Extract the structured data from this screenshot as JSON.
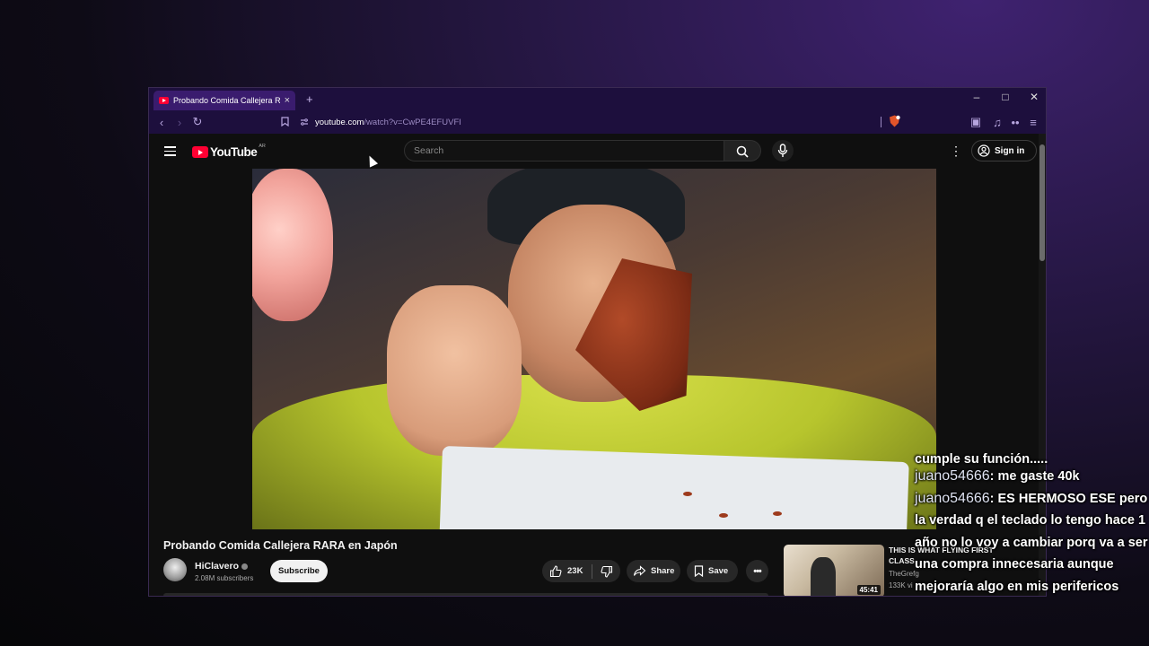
{
  "browser": {
    "tab_title": "Probando Comida Callejera RAR",
    "new_tab_label": "+",
    "close_label": "×",
    "url_host": "youtube.com",
    "url_path": "/watch?v=CwPE4EFUVFI",
    "window_controls": {
      "minimize": "–",
      "maximize": "□",
      "close": "✕"
    }
  },
  "youtube": {
    "logo_text": "YouTube",
    "country_code": "AR",
    "search_placeholder": "Search",
    "signin_label": "Sign in"
  },
  "video": {
    "title": "Probando Comida Callejera RARA en Japón",
    "channel": "HiClavero",
    "subscribers": "2.08M subscribers",
    "subscribe_label": "Subscribe",
    "likes": "23K",
    "share_label": "Share",
    "save_label": "Save"
  },
  "recommended": {
    "title_line1": "THIS IS WHAT FLYING FIRST",
    "title_line2": "CLASS",
    "channel": "TheGrefg",
    "views": "133K vi",
    "duration": "45:41"
  },
  "chat": {
    "partial": "cumple su función.....",
    "messages": [
      {
        "user": "juano54666",
        "text": ": me gaste 40k"
      },
      {
        "user": "juano54666",
        "text": ": ES HERMOSO ESE pero la verdad q el teclado lo tengo hace 1 año no lo voy a cambiar porq va a ser una compra innecesaria aunque mejoraría algo en mis perifericos"
      }
    ]
  },
  "colors": {
    "youtube_red": "#ff0033",
    "browser_chrome": "#1d0f3d",
    "yt_background": "#0f0f0f"
  }
}
